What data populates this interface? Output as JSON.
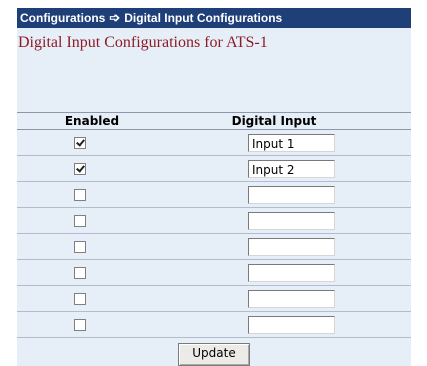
{
  "breadcrumb": {
    "section": "Configurations",
    "separator_icon": "arrow-right-icon",
    "page": "Digital Input Configurations"
  },
  "panel": {
    "title": "Digital Input Configurations for ATS-1"
  },
  "table": {
    "headers": {
      "enabled": "Enabled",
      "digital_input": "Digital Input"
    },
    "rows": [
      {
        "enabled": true,
        "input": "Input 1"
      },
      {
        "enabled": true,
        "input": "Input 2"
      },
      {
        "enabled": false,
        "input": ""
      },
      {
        "enabled": false,
        "input": ""
      },
      {
        "enabled": false,
        "input": ""
      },
      {
        "enabled": false,
        "input": ""
      },
      {
        "enabled": false,
        "input": ""
      },
      {
        "enabled": false,
        "input": ""
      }
    ]
  },
  "actions": {
    "update_label": "Update"
  },
  "colors": {
    "header_bar": "#1f3f79",
    "panel_bg": "#e6eff8",
    "title_text": "#8c1c26"
  }
}
